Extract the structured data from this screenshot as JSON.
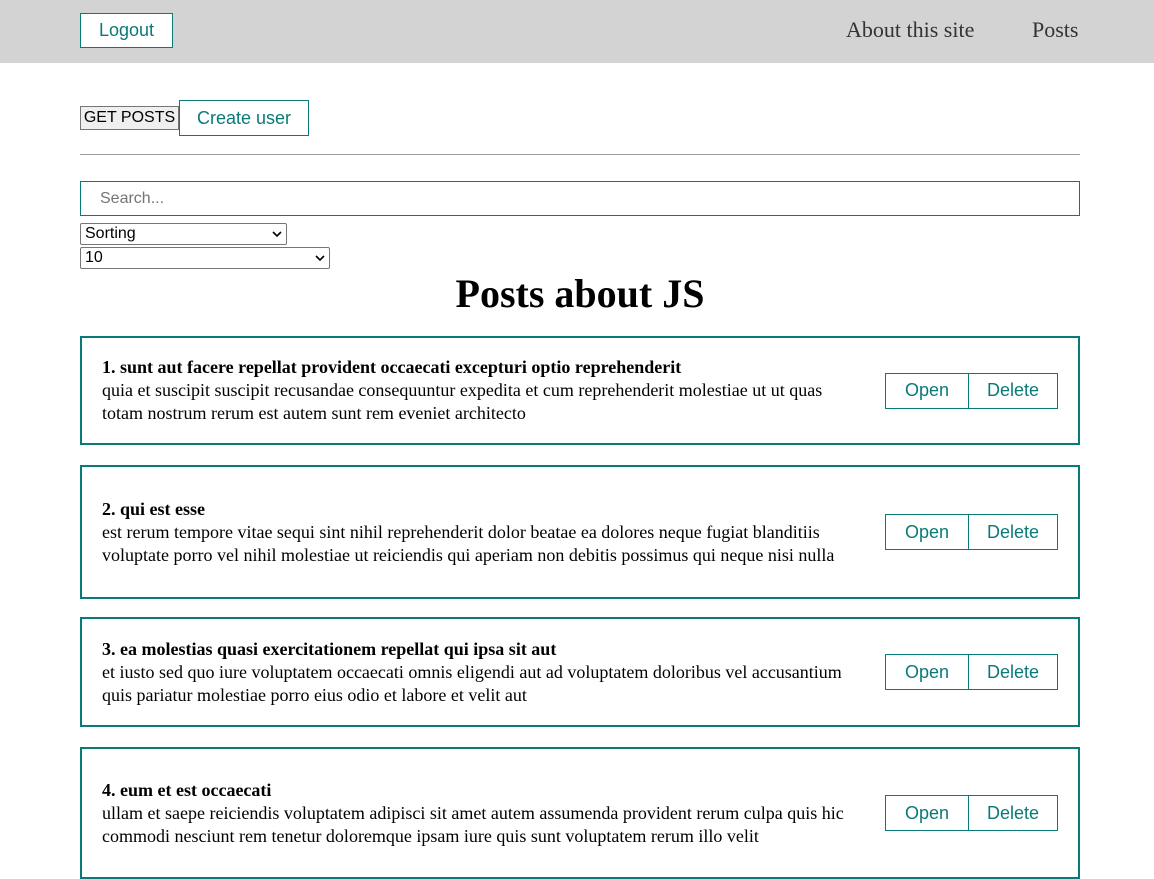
{
  "navbar": {
    "logout_label": "Logout",
    "links": [
      "About this site",
      "Posts"
    ]
  },
  "actions": {
    "get_posts_label": "GET POSTS",
    "create_user_label": "Create user"
  },
  "search": {
    "placeholder": "Search...",
    "value": ""
  },
  "sort_select": {
    "selected": "Sorting"
  },
  "limit_select": {
    "selected": "10"
  },
  "page_title": "Posts about JS",
  "posts": [
    {
      "title": "1. sunt aut facere repellat provident occaecati excepturi optio reprehenderit",
      "body": "quia et suscipit suscipit recusandae consequuntur expedita et cum reprehenderit molestiae ut ut quas totam nostrum rerum est autem sunt rem eveniet architecto"
    },
    {
      "title": "2. qui est esse",
      "body": "est rerum tempore vitae sequi sint nihil reprehenderit dolor beatae ea dolores neque fugiat blanditiis voluptate porro vel nihil molestiae ut reiciendis qui aperiam non debitis possimus qui neque nisi nulla"
    },
    {
      "title": "3. ea molestias quasi exercitationem repellat qui ipsa sit aut",
      "body": "et iusto sed quo iure voluptatem occaecati omnis eligendi aut ad voluptatem doloribus vel accusantium quis pariatur molestiae porro eius odio et labore et velit aut"
    },
    {
      "title": "4. eum et est occaecati",
      "body": "ullam et saepe reiciendis voluptatem adipisci sit amet autem assumenda provident rerum culpa quis hic commodi nesciunt rem tenetur doloremque ipsam iure quis sunt voluptatem rerum illo velit"
    }
  ],
  "post_buttons": {
    "open_label": "Open",
    "delete_label": "Delete"
  },
  "colors": {
    "accent": "#0a7a78",
    "navbar_bg": "#d3d3d3"
  }
}
